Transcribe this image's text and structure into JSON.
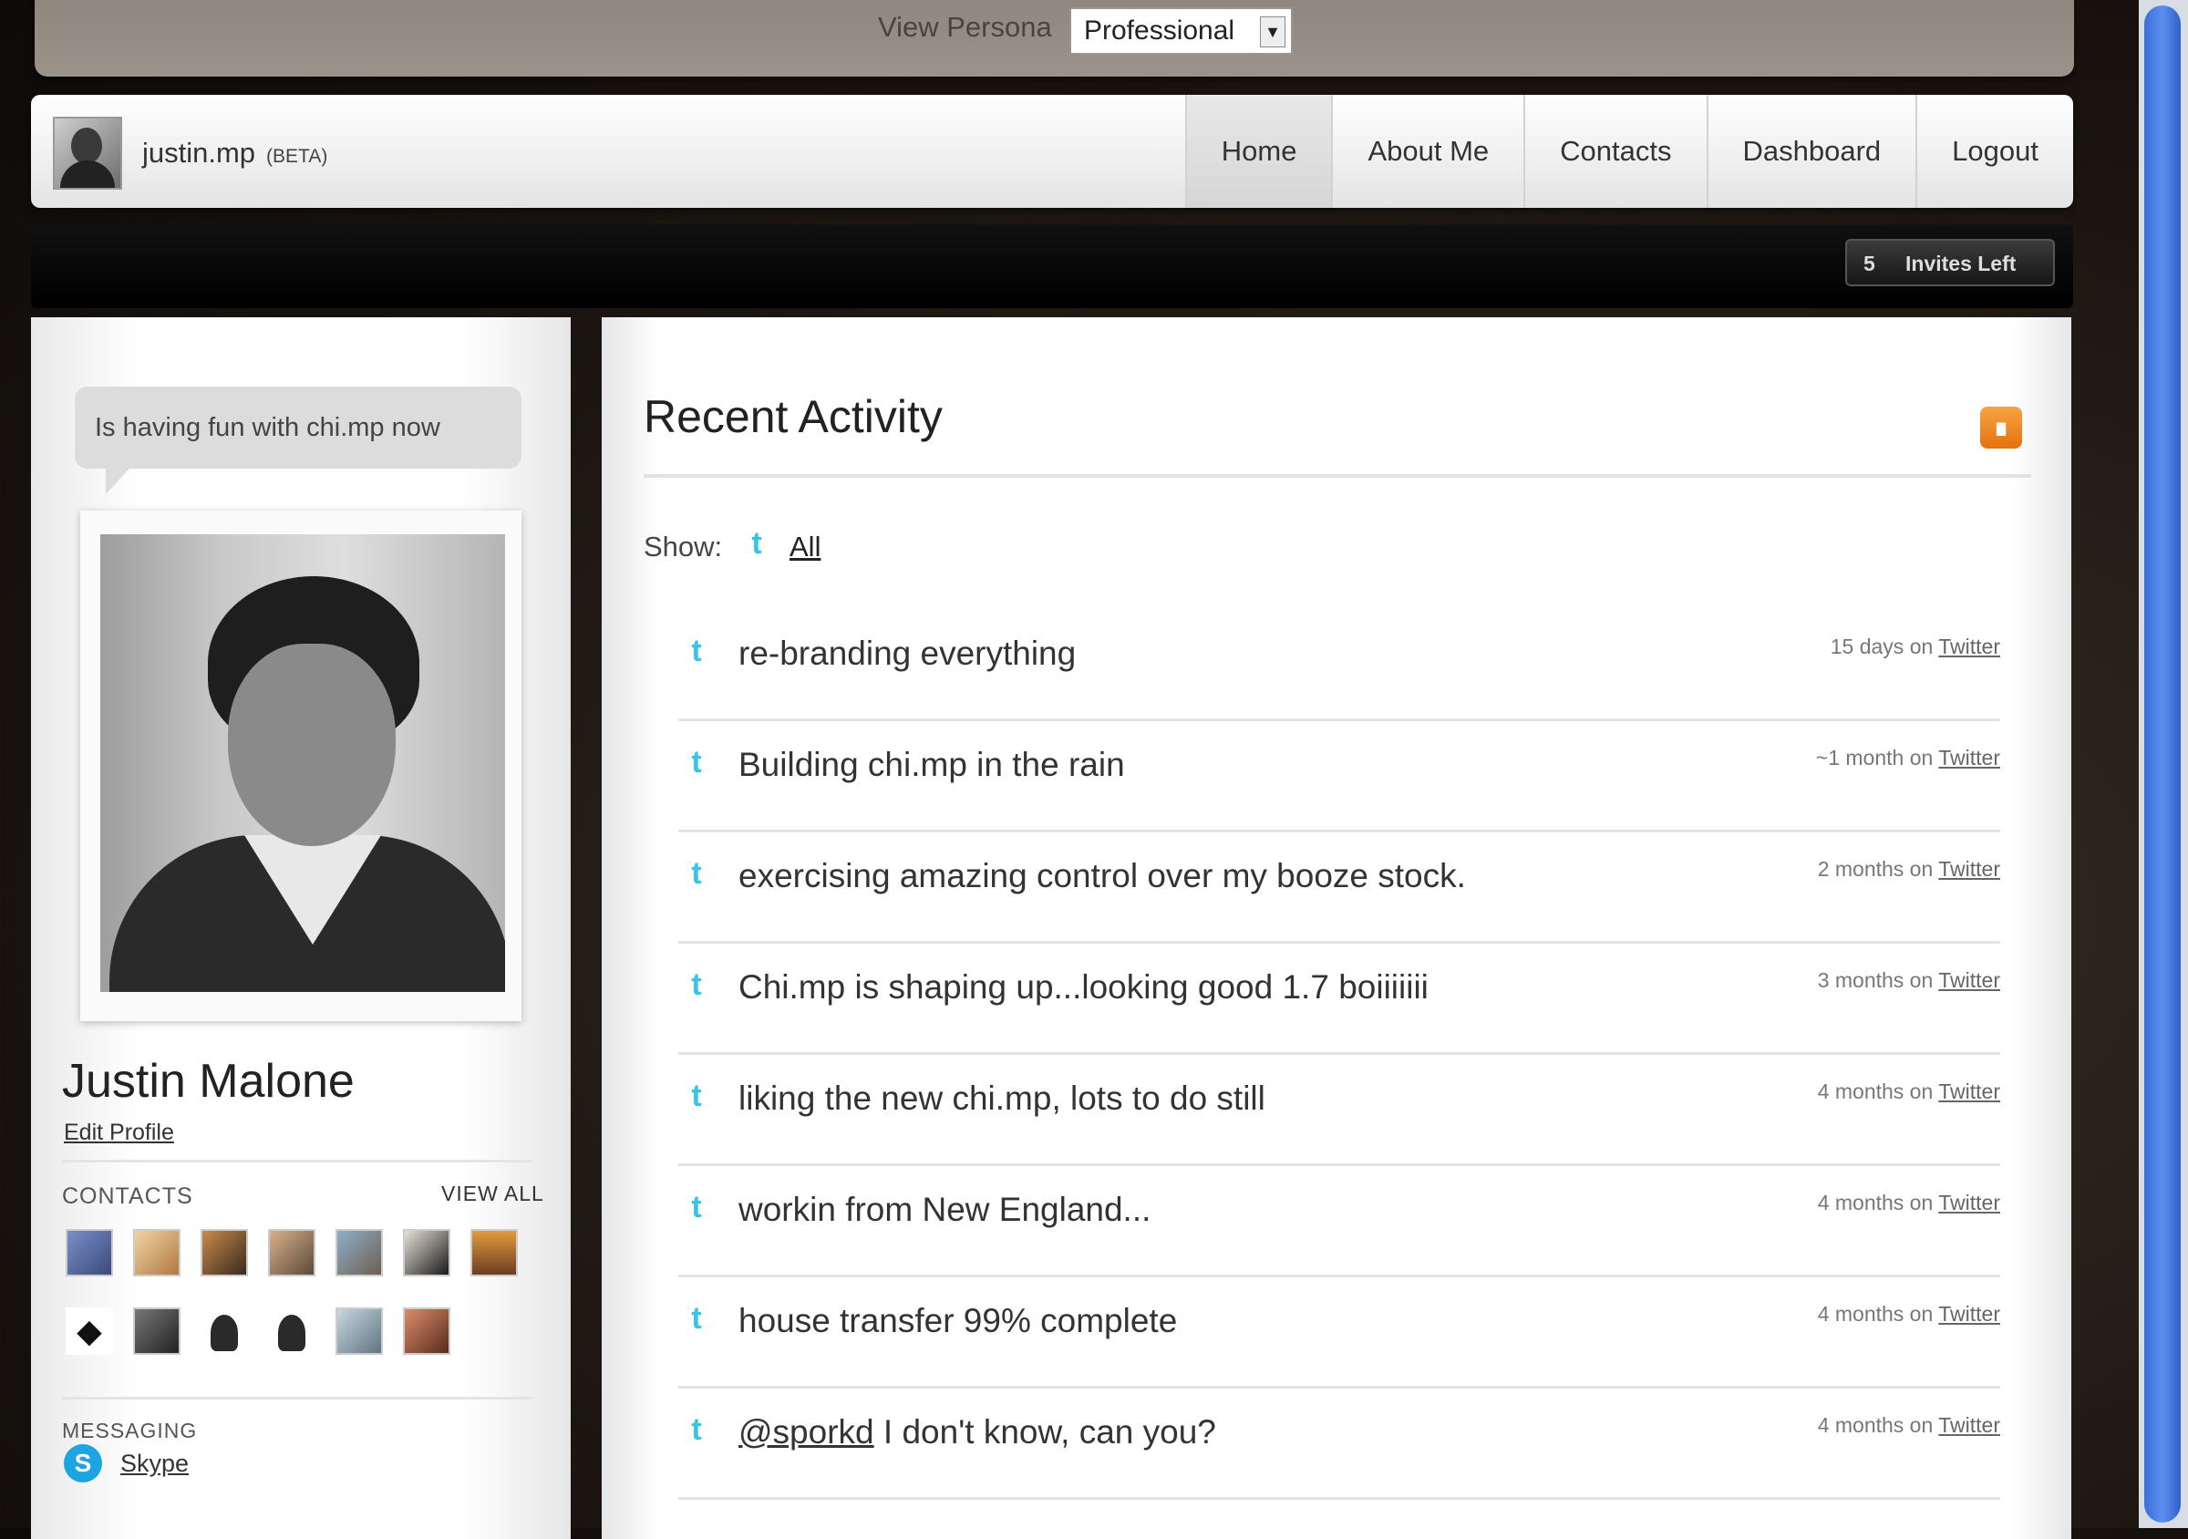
{
  "persona": {
    "label": "View Persona",
    "selected": "Professional"
  },
  "nav": {
    "brand": "justin.mp",
    "beta": "(BETA)",
    "links": [
      "Home",
      "About Me",
      "Contacts",
      "Dashboard",
      "Logout"
    ],
    "active": "Home"
  },
  "invites": {
    "count": "5",
    "label": "Invites Left"
  },
  "profile": {
    "status": "Is having fun with chi.mp now",
    "name": "Justin Malone",
    "edit_profile": "Edit Profile",
    "contacts_title": "CONTACTS",
    "view_all": "VIEW ALL",
    "messaging_title": "MESSAGING",
    "skype_label": "Skype"
  },
  "activity": {
    "title": "Recent Activity",
    "show_label": "Show:",
    "filter_all": "All",
    "items": [
      {
        "text": "re-branding everything",
        "when": "15 days on",
        "source": "Twitter"
      },
      {
        "text": "Building chi.mp in the rain",
        "when": "~1 month on",
        "source": "Twitter"
      },
      {
        "text": "exercising amazing control over my booze stock.",
        "when": "2 months on",
        "source": "Twitter"
      },
      {
        "text": "Chi.mp is shaping up...looking good 1.7 boiiiiiii",
        "when": "3 months on",
        "source": "Twitter"
      },
      {
        "text": "liking the new chi.mp, lots to do still",
        "when": "4 months on",
        "source": "Twitter"
      },
      {
        "text": "workin from New England...",
        "when": "4 months on",
        "source": "Twitter"
      },
      {
        "text": "house transfer 99% complete",
        "when": "4 months on",
        "source": "Twitter"
      },
      {
        "mention": "@sporkd",
        "text": " I don't know, can you?",
        "when": "4 months on",
        "source": "Twitter"
      }
    ]
  },
  "colors": {
    "accent_twitter": "#36c5e8",
    "rss": "#e4710f",
    "skype": "#1ea3e3"
  }
}
